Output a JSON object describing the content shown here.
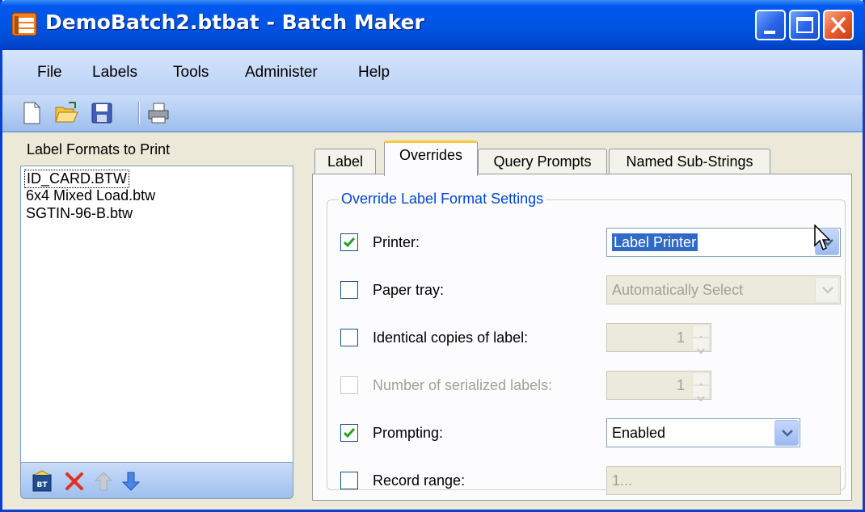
{
  "window": {
    "title": "DemoBatch2.btbat - Batch Maker"
  },
  "menu": [
    "File",
    "Labels",
    "Tools",
    "Administer",
    "Help"
  ],
  "toolbar": [
    "new-icon",
    "open-icon",
    "save-icon",
    "print-icon"
  ],
  "left_panel": {
    "title": "Label Formats to Print",
    "items": [
      "ID_CARD.BTW",
      "6x4 Mixed Load.btw",
      "SGTIN-96-B.btw"
    ],
    "selected_index": 0,
    "toolbar": [
      "add-format-icon",
      "delete-icon",
      "move-up-icon",
      "move-down-icon"
    ]
  },
  "tabs": [
    "Label",
    "Overrides",
    "Query Prompts",
    "Named Sub-Strings"
  ],
  "active_tab": "Overrides",
  "overrides": {
    "group_title": "Override Label Format Settings",
    "rows": [
      {
        "label": "Printer:",
        "checked": true,
        "enabled": true,
        "control": "dropdown",
        "value": "Label Printer",
        "control_enabled": true
      },
      {
        "label": "Paper tray:",
        "checked": false,
        "enabled": true,
        "control": "dropdown",
        "value": "Automatically Select",
        "control_enabled": false
      },
      {
        "label": "Identical copies of label:",
        "checked": false,
        "enabled": true,
        "control": "spinner",
        "value": "1",
        "control_enabled": false
      },
      {
        "label": "Number of serialized labels:",
        "checked": false,
        "enabled": false,
        "control": "spinner",
        "value": "1",
        "control_enabled": false
      },
      {
        "label": "Prompting:",
        "checked": true,
        "enabled": true,
        "control": "dropdown",
        "value": "Enabled",
        "control_enabled": true
      },
      {
        "label": "Record range:",
        "checked": false,
        "enabled": true,
        "control": "text",
        "value": "1...",
        "control_enabled": false
      }
    ]
  },
  "colors": {
    "titlebar": "#0054e3",
    "group_title": "#0046d5",
    "selection": "#316ac5",
    "active_tab_accent": "#ffc83c"
  }
}
